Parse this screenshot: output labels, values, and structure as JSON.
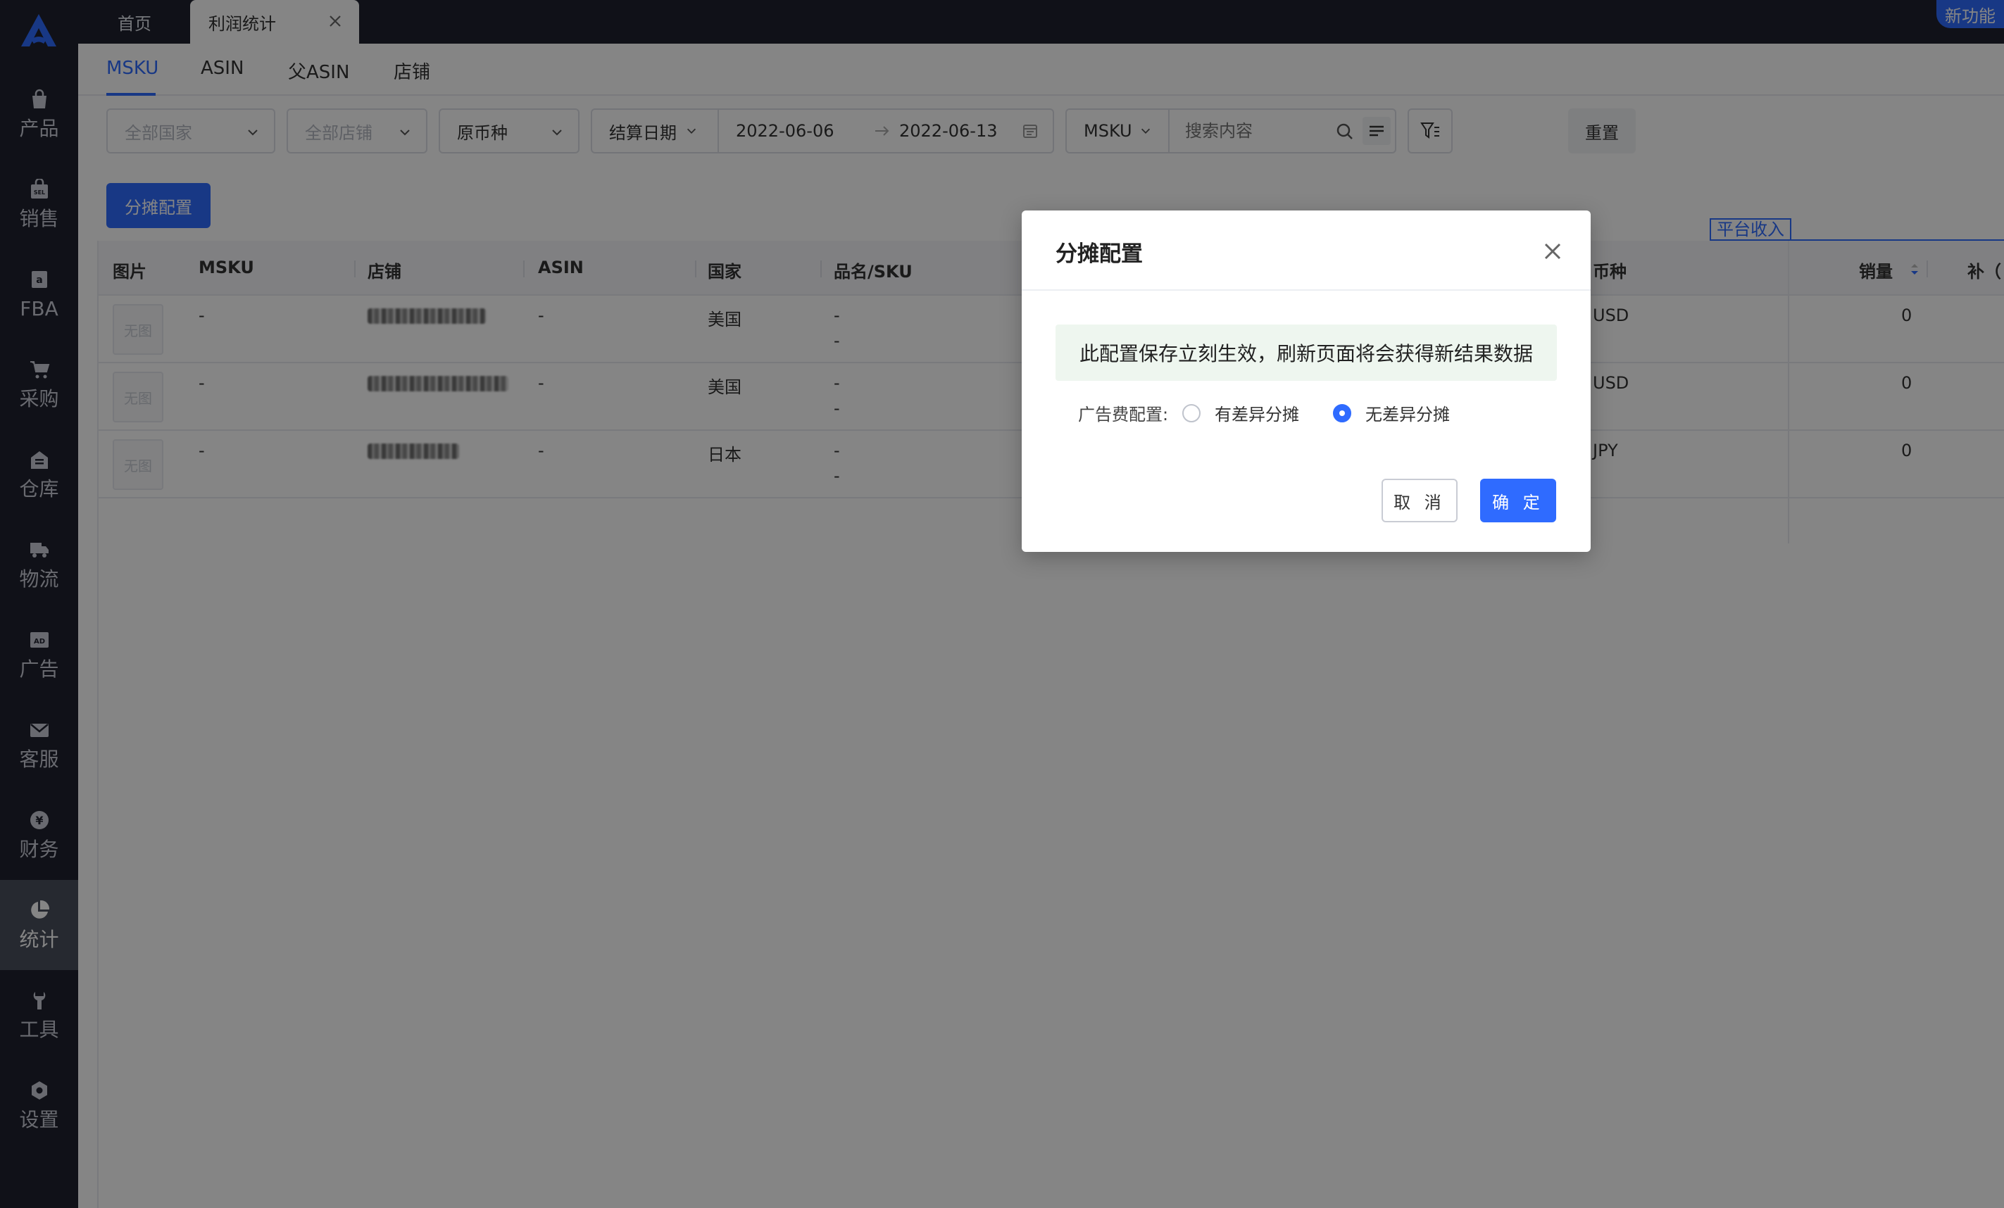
{
  "sidebar": {
    "items": [
      {
        "label": "产品",
        "icon": "bag-icon"
      },
      {
        "label": "销售",
        "icon": "sell-icon"
      },
      {
        "label": "FBA",
        "icon": "amazon-icon"
      },
      {
        "label": "采购",
        "icon": "cart-icon"
      },
      {
        "label": "仓库",
        "icon": "warehouse-icon"
      },
      {
        "label": "物流",
        "icon": "truck-icon"
      },
      {
        "label": "广告",
        "icon": "ad-icon"
      },
      {
        "label": "客服",
        "icon": "mail-icon"
      },
      {
        "label": "财务",
        "icon": "yen-icon"
      },
      {
        "label": "统计",
        "icon": "pie-chart-icon",
        "active": true
      },
      {
        "label": "工具",
        "icon": "wrench-icon"
      },
      {
        "label": "设置",
        "icon": "gear-icon"
      }
    ]
  },
  "topbar": {
    "home_tab": "首页",
    "active_tab": "利润统计",
    "new_feature": "新功能"
  },
  "subtabs": [
    "MSKU",
    "ASIN",
    "父ASIN",
    "店铺"
  ],
  "filters": {
    "country": "全部国家",
    "shop": "全部店铺",
    "currency": "原币种",
    "date_type": "结算日期",
    "date_start": "2022-06-06",
    "date_end": "2022-06-13",
    "search_field": "MSKU",
    "search_placeholder": "搜索内容",
    "reset": "重置"
  },
  "alloc_button": "分摊配置",
  "platform_income": "平台收入",
  "table": {
    "headers": [
      "图片",
      "MSKU",
      "店铺",
      "ASIN",
      "国家",
      "品名/SKU",
      "币种",
      "销量",
      "补（"
    ],
    "no_image": "无图",
    "rows": [
      {
        "msku": "-",
        "asin": "-",
        "country": "美国",
        "name": "-",
        "sku": "-",
        "currency": "USD",
        "sales": "0"
      },
      {
        "msku": "-",
        "asin": "-",
        "country": "美国",
        "name": "-",
        "sku": "-",
        "currency": "USD",
        "sales": "0"
      },
      {
        "msku": "-",
        "asin": "-",
        "country": "日本",
        "name": "-",
        "sku": "-",
        "currency": "JPY",
        "sales": "0"
      }
    ]
  },
  "modal": {
    "title": "分摊配置",
    "notice": "此配置保存立刻生效，刷新页面将会获得新结果数据",
    "field_label": "广告费配置:",
    "option_diff": "有差异分摊",
    "option_nodiff": "无差异分摊",
    "selected": "无差异分摊",
    "cancel": "取 消",
    "ok": "确 定"
  },
  "colors": {
    "accent": "#2f6bff",
    "sidebar_bg": "#1f222e"
  }
}
